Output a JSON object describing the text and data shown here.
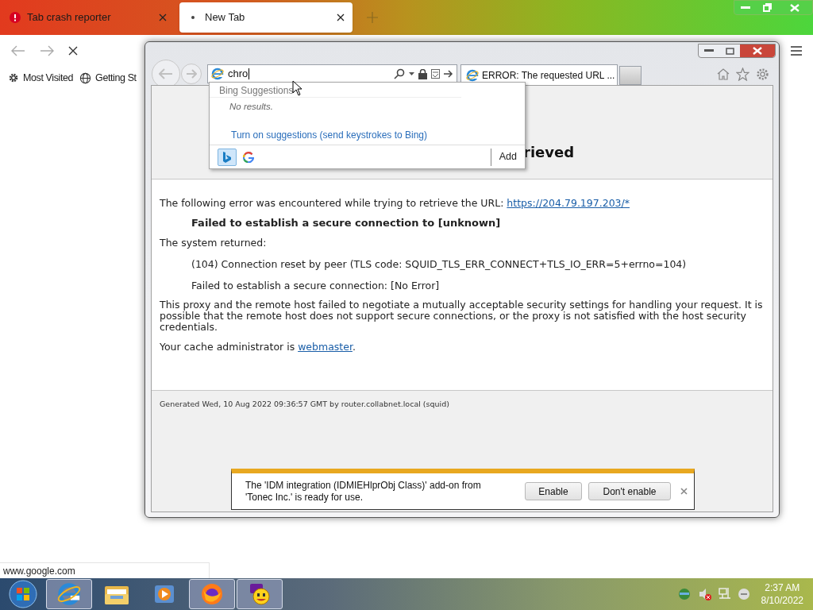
{
  "firefox": {
    "tabs": [
      {
        "kind": "crash",
        "title": "Tab crash reporter",
        "selected": false
      },
      {
        "kind": "blank",
        "title": "New Tab",
        "selected": true
      }
    ],
    "bookmarks": [
      {
        "kind": "gear",
        "label": "Most Visited"
      },
      {
        "kind": "globe",
        "label": "Getting St"
      }
    ],
    "status": "www.google.com"
  },
  "ie": {
    "address": "chro",
    "tabs": [
      {
        "title": "ERROR: The requested URL ...",
        "selected": true
      }
    ],
    "suggestions": {
      "header": "Bing Suggestions",
      "empty": "No results.",
      "link": "Turn on suggestions (send keystrokes to Bing)",
      "providers": [
        {
          "kind": "bing",
          "selected": true
        },
        {
          "kind": "google",
          "selected": false
        }
      ],
      "add": "Add"
    },
    "page": {
      "heading": "rieved",
      "intro": "The following error was encountered while trying to retrieve the URL: ",
      "url": "https://204.79.197.203/*",
      "error": "Failed to establish a secure connection to [unknown]",
      "returned_label": "The system returned:",
      "details": [
        "(104) Connection reset by peer (TLS code: SQUID_TLS_ERR_CONNECT+TLS_IO_ERR=5+errno=104)",
        "Failed to establish a secure connection: [No Error]"
      ],
      "explanation": "This proxy and the remote host failed to negotiate a mutually acceptable security settings for handling your request. It is possible that the remote host does not support secure connections, or the proxy is not satisfied with the host security credentials.",
      "admin_prefix": "Your cache administrator is ",
      "admin_link": "webmaster",
      "admin_suffix": ".",
      "generated": "Generated Wed, 10 Aug 2022 09:36:57 GMT by router.collabnet.local (squid)"
    },
    "notification": {
      "message": "The 'IDM integration (IDMIEHlprObj Class)' add-on from 'Tonec Inc.' is ready for use.",
      "buttons": [
        "Enable",
        "Don't enable"
      ]
    }
  },
  "taskbar": {
    "apps": [
      {
        "kind": "ie",
        "active": true
      },
      {
        "kind": "explorer",
        "active": false
      },
      {
        "kind": "media",
        "active": false
      },
      {
        "kind": "firefox",
        "active": true
      },
      {
        "kind": "messenger",
        "active": true
      }
    ],
    "time": "2:37 AM",
    "date": "8/10/2022"
  }
}
